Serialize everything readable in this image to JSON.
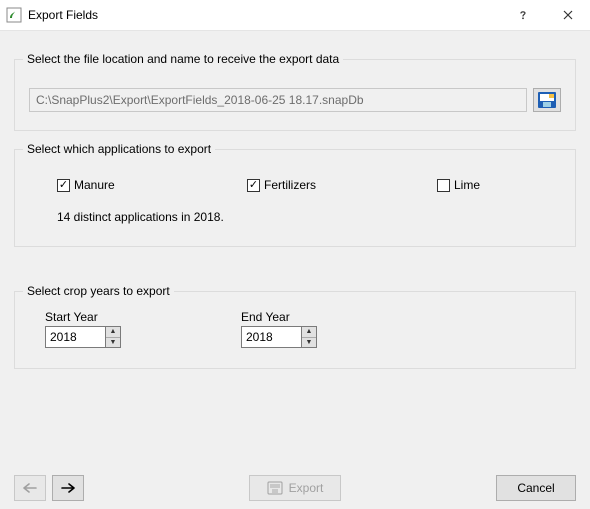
{
  "window": {
    "title": "Export Fields"
  },
  "file_group": {
    "legend": "Select the file location and name to receive the export data",
    "path": "C:\\SnapPlus2\\Export\\ExportFields_2018-06-25 18.17.snapDb"
  },
  "apps_group": {
    "legend": "Select which applications to export",
    "options": [
      {
        "label": "Manure",
        "checked": true
      },
      {
        "label": "Fertilizers",
        "checked": true
      },
      {
        "label": "Lime",
        "checked": false
      }
    ],
    "status": "14 distinct applications in 2018."
  },
  "years_group": {
    "legend": "Select crop years to export",
    "start_label": "Start Year",
    "start_value": "2018",
    "end_label": "End Year",
    "end_value": "2018"
  },
  "buttons": {
    "export": "Export",
    "cancel": "Cancel"
  }
}
